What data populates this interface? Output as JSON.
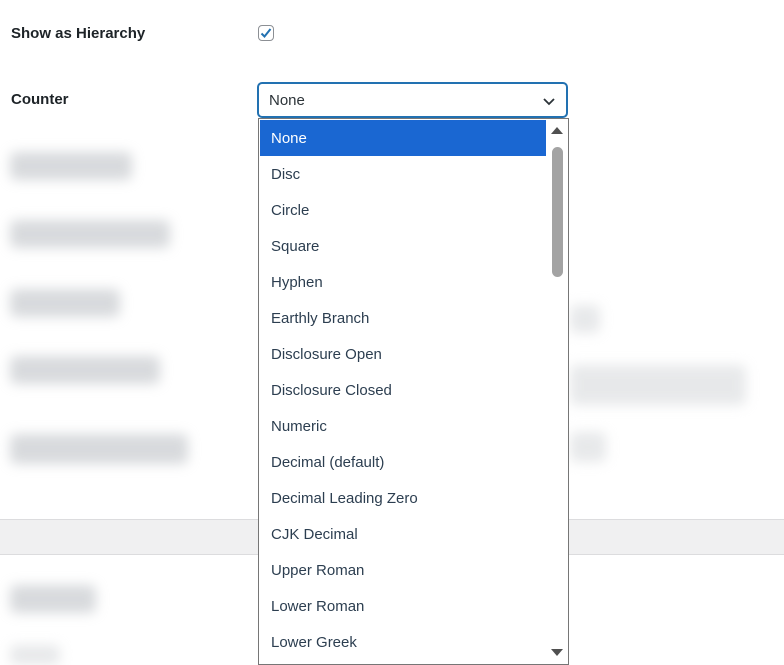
{
  "settings": {
    "hierarchy_label": "Show as Hierarchy",
    "hierarchy_checked": true,
    "counter_label": "Counter",
    "counter_value": "None"
  },
  "dropdown": {
    "options": [
      "None",
      "Disc",
      "Circle",
      "Square",
      "Hyphen",
      "Earthly Branch",
      "Disclosure Open",
      "Disclosure Closed",
      "Numeric",
      "Decimal (default)",
      "Decimal Leading Zero",
      "CJK Decimal",
      "Upper Roman",
      "Lower Roman",
      "Lower Greek"
    ],
    "selected_index": 0
  },
  "colors": {
    "accent": "#2271b1",
    "selected_bg": "#1a67d2",
    "option_text": "#2c3e50"
  },
  "icons": {
    "checkbox": "checkmark-icon",
    "select_arrow": "chevron-down-icon",
    "scroll_up": "triangle-up-icon",
    "scroll_down": "triangle-down-icon"
  }
}
